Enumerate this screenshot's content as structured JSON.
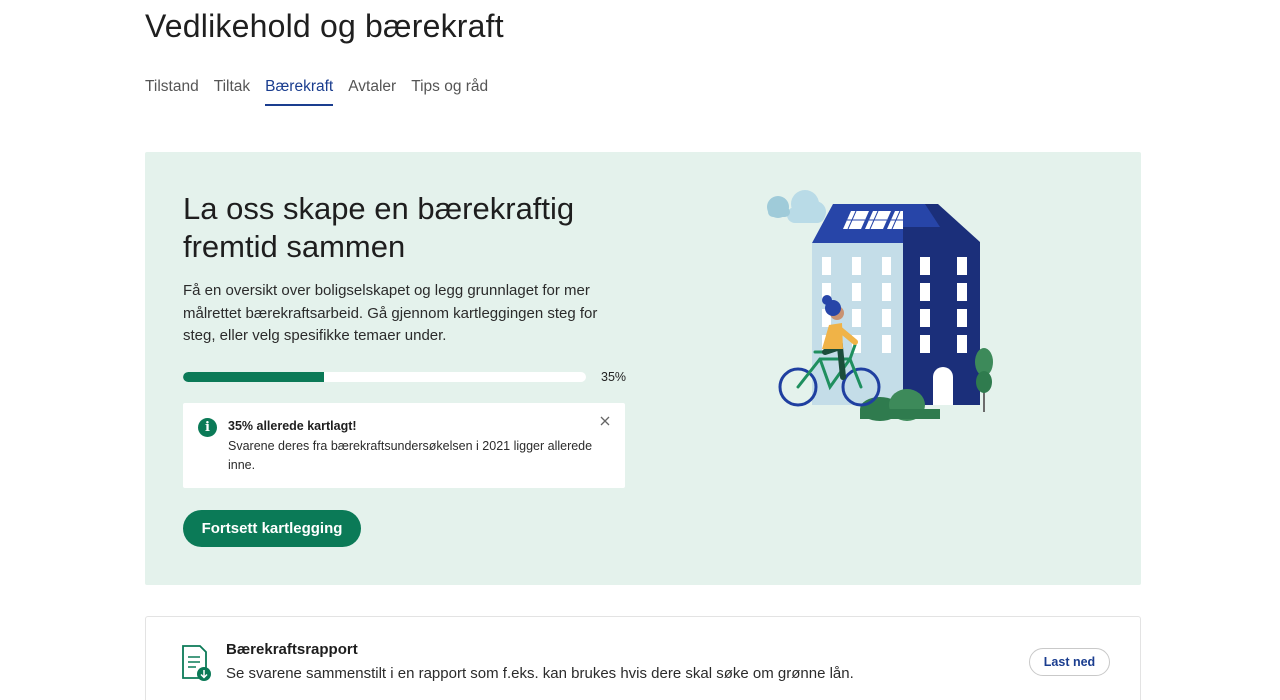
{
  "page": {
    "title": "Vedlikehold og bærekraft"
  },
  "tabs": [
    {
      "label": "Tilstand",
      "active": false
    },
    {
      "label": "Tiltak",
      "active": false
    },
    {
      "label": "Bærekraft",
      "active": true
    },
    {
      "label": "Avtaler",
      "active": false
    },
    {
      "label": "Tips og råd",
      "active": false
    }
  ],
  "hero": {
    "title": "La oss skape en bærekraftig fremtid sammen",
    "description": "Få en oversikt over boligselskapet og legg grunnlaget for mer målrettet bærekraftsarbeid. Gå gjennom kartleggingen steg for steg, eller velg spesifikke temaer under.",
    "progress": {
      "value": 35,
      "label": "35%"
    },
    "notice": {
      "title": "35% allerede kartlagt!",
      "body": "Svarene deres fra bærekraftsundersøkelsen i 2021 ligger allerede inne.",
      "icon": "info-icon"
    },
    "cta_label": "Fortsett kartlegging"
  },
  "report": {
    "title": "Bærekraftsrapport",
    "description": "Se svarene sammenstilt i en rapport som f.eks. kan brukes hvis dere skal søke om grønne lån.",
    "button_label": "Last ned",
    "icon": "document-download-icon"
  },
  "colors": {
    "accent_green": "#0b7a57",
    "hero_background": "#e4f2ec",
    "active_tab": "#1a3d8f",
    "building_dark": "#1b2f7a",
    "building_light": "#c4dde8"
  }
}
